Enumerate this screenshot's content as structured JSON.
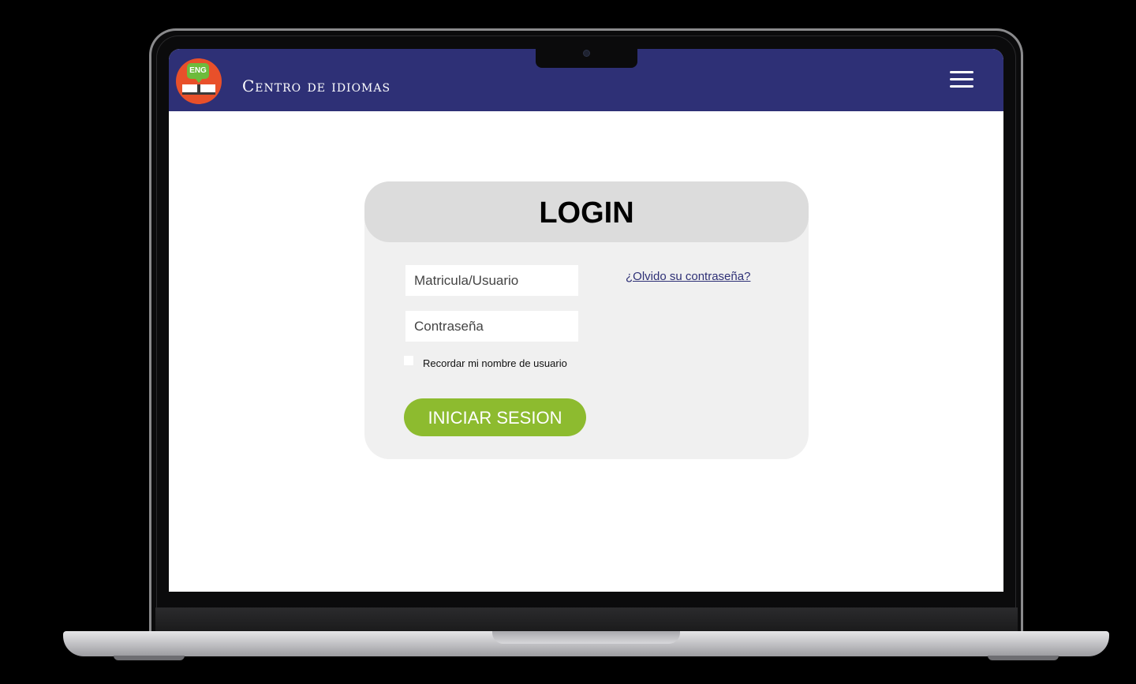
{
  "app": {
    "logo_text": "ENG",
    "title": "Centro de idiomas",
    "menu_icon": "hamburger-icon"
  },
  "login": {
    "title": "LOGIN",
    "username_placeholder": "Matricula/Usuario",
    "password_placeholder": "Contraseña",
    "forgot_link": "¿Olvido su contraseña?",
    "remember_label": "Recordar mi nombre de usuario",
    "remember_checked": false,
    "submit_label": "INICIAR SESION"
  },
  "colors": {
    "header_bg": "#2e3076",
    "logo_bg": "#e8502a",
    "logo_bubble": "#6dbb3c",
    "card_bg": "#f0f0f0",
    "card_header_bg": "#dcdcdc",
    "button_bg": "#8dbb2f",
    "link": "#2e3076"
  }
}
